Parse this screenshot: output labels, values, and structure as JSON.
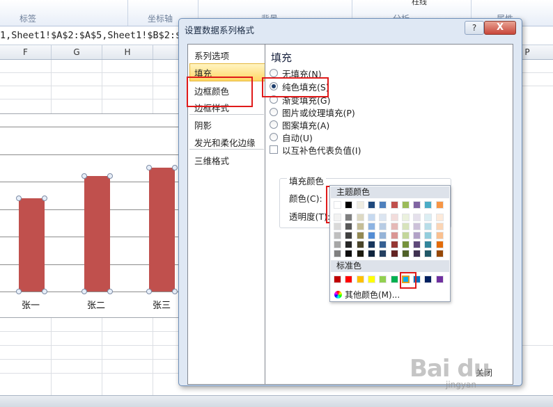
{
  "ribbon": {
    "groups": [
      "标签",
      "坐标轴",
      "背景",
      "分析",
      "属性"
    ],
    "top_label": "柱线"
  },
  "formula_bar": {
    "text": "1,Sheet1!$A$2:$A$5,Sheet1!$B$2:$"
  },
  "columns": [
    "F",
    "G",
    "H",
    "P"
  ],
  "chart_data": {
    "type": "bar",
    "categories": [
      "张一",
      "张二",
      "张三"
    ],
    "values": [
      3.4,
      4.2,
      4.5
    ],
    "color": "#c0504d",
    "ylim": [
      0,
      6
    ],
    "grid": true
  },
  "dialog": {
    "title": "设置数据系列格式",
    "help": "?",
    "close": "X",
    "nav": [
      "系列选项",
      "填充",
      "边框颜色",
      "边框样式",
      "阴影",
      "发光和柔化边缘",
      "三维格式"
    ],
    "nav_selected": "填充",
    "fill": {
      "title": "填充",
      "options": [
        "无填充(N)",
        "纯色填充(S)",
        "渐变填充(G)",
        "图片或纹理填充(P)",
        "图案填充(A)",
        "自动(U)"
      ],
      "selected": "纯色填充(S)",
      "invert_label": "以互补色代表负值(I)",
      "group_title": "填充颜色",
      "color_label": "颜色(C):",
      "transparency_label": "透明度(T):"
    },
    "close_button": "关闭"
  },
  "palette": {
    "theme_header": "主题颜色",
    "standard_header": "标准色",
    "more_colors": "其他颜色(M)...",
    "theme_top": [
      "#ffffff",
      "#000000",
      "#eeece1",
      "#1f497d",
      "#4f81bd",
      "#c0504d",
      "#9bbb59",
      "#8064a2",
      "#4bacc6",
      "#f79646"
    ],
    "theme_shades": [
      [
        "#f2f2f2",
        "#d9d9d9",
        "#bfbfbf",
        "#a6a6a6",
        "#808080"
      ],
      [
        "#7f7f7f",
        "#595959",
        "#404040",
        "#262626",
        "#0d0d0d"
      ],
      [
        "#ddd9c3",
        "#c4bd97",
        "#938953",
        "#4a452a",
        "#1d1b10"
      ],
      [
        "#c6d9f0",
        "#8db3e2",
        "#548dd4",
        "#17365d",
        "#0f243e"
      ],
      [
        "#dbe5f1",
        "#b8cce4",
        "#95b3d7",
        "#366092",
        "#244061"
      ],
      [
        "#f2dcdb",
        "#e5b9b7",
        "#d99694",
        "#953734",
        "#632423"
      ],
      [
        "#ebf1dd",
        "#d7e3bc",
        "#c3d69b",
        "#76923c",
        "#4f6128"
      ],
      [
        "#e5e0ec",
        "#ccc1d9",
        "#b2a2c7",
        "#5f497a",
        "#3f3151"
      ],
      [
        "#dbeef3",
        "#b7dde8",
        "#92cddc",
        "#31859b",
        "#205867"
      ],
      [
        "#fdeada",
        "#fbd5b5",
        "#fac08f",
        "#e36c09",
        "#974806"
      ]
    ],
    "standard": [
      "#c00000",
      "#ff0000",
      "#ffc000",
      "#ffff00",
      "#92d050",
      "#00b050",
      "#00b0f0",
      "#0070c0",
      "#002060",
      "#7030a0"
    ],
    "selected_standard": "#00b0f0"
  },
  "watermark": {
    "text": "Bai du",
    "sub": "jingyan"
  }
}
